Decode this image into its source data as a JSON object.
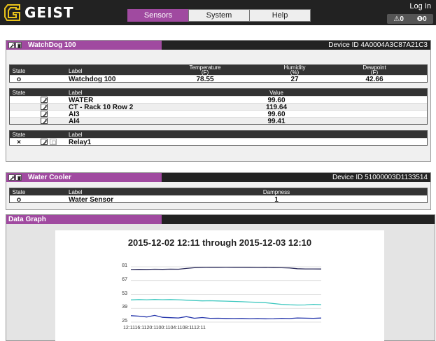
{
  "header": {
    "logo_text": "GEIST",
    "nav": [
      "Sensors",
      "System",
      "Help"
    ],
    "active_nav": 0,
    "login": "Log In",
    "alarm_count": "0",
    "warning_count": "0"
  },
  "watchdog": {
    "title": "WatchDog 100",
    "device_id": "Device ID 4A0004A3C87A21C3",
    "main_table": {
      "headers": {
        "state": "State",
        "label": "Label",
        "temperature": "Temperature",
        "temperature_unit": "(F)",
        "humidity": "Humidity",
        "humidity_unit": "(%)",
        "dewpoint": "Dewpoint",
        "dewpoint_unit": "(F)"
      },
      "row": {
        "state": "o",
        "label": "Watchdog 100",
        "temperature": "78.55",
        "humidity": "27",
        "dewpoint": "42.66"
      }
    },
    "analog_table": {
      "headers": {
        "state": "State",
        "label": "Label",
        "value": "Value"
      },
      "rows": [
        {
          "label": "WATER",
          "value": "99.60"
        },
        {
          "label": "CT - Rack 10 Row 2",
          "value": "119.64"
        },
        {
          "label": "AI3",
          "value": "99.60"
        },
        {
          "label": "AI4",
          "value": "99.41"
        }
      ]
    },
    "relay_table": {
      "headers": {
        "state": "State",
        "label": "Label"
      },
      "row": {
        "state": "×",
        "label": "Relay1"
      }
    }
  },
  "water_cooler": {
    "title": "Water Cooler",
    "device_id": "Device ID 51000003D1133514",
    "headers": {
      "state": "State",
      "label": "Label",
      "dampness": "Dampness"
    },
    "row": {
      "state": "o",
      "label": "Water Sensor",
      "dampness": "1"
    }
  },
  "graph": {
    "panel_title": "Data Graph",
    "chart_data": {
      "type": "line",
      "title": "2015-12-02 12:11 through 2015-12-03 12:10",
      "xlabel": "",
      "ylabel": "",
      "ylim": [
        25,
        81
      ],
      "yticks": [
        81,
        67,
        53,
        39,
        25
      ],
      "xtick_labels": "12:1116:1120:1100:1104:1108:1112:11",
      "x": [
        0,
        1,
        2,
        3,
        4,
        5,
        6,
        7,
        8,
        9,
        10,
        11,
        12,
        13,
        14,
        15,
        16,
        17,
        18,
        19,
        20,
        21,
        22,
        23,
        24
      ],
      "series": [
        {
          "color": "#2a2a5a",
          "values": [
            78.2,
            78.4,
            78.3,
            78.5,
            78.4,
            78.6,
            78.5,
            79.3,
            80.1,
            80.4,
            80.6,
            80.5,
            80.6,
            80.5,
            80.5,
            80.4,
            80.2,
            80.3,
            80.1,
            80.0,
            79.8,
            79.0,
            78.8,
            78.8,
            78.7
          ]
        },
        {
          "color": "#40c8c0",
          "values": [
            47.5,
            47.8,
            47.6,
            47.9,
            47.7,
            47.8,
            47.6,
            47.2,
            46.8,
            46.5,
            46.6,
            46.4,
            46.2,
            45.9,
            45.6,
            45.3,
            45.0,
            44.6,
            43.8,
            42.9,
            42.5,
            42.3,
            42.4,
            42.9,
            42.6
          ]
        },
        {
          "color": "#2233aa",
          "values": [
            31.5,
            31.0,
            30.2,
            31.8,
            29.8,
            29.5,
            29.2,
            30.5,
            28.9,
            29.6,
            28.8,
            28.9,
            28.7,
            28.6,
            28.7,
            28.5,
            28.6,
            28.3,
            28.5,
            28.8,
            28.6,
            29.2,
            29.0,
            28.8,
            29.1
          ]
        }
      ]
    }
  }
}
